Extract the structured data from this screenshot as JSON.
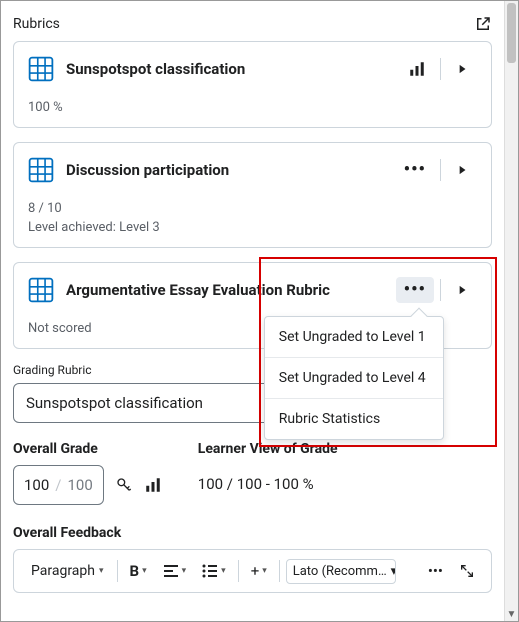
{
  "header": {
    "title": "Rubrics"
  },
  "rubrics": [
    {
      "title": "Sunspotspot classification",
      "score_text": "100 %",
      "level_text": null,
      "show_chart": true,
      "show_more": false
    },
    {
      "title": "Discussion participation",
      "score_text": "8 / 10",
      "level_text": "Level achieved: Level 3",
      "show_chart": false,
      "show_more": true
    },
    {
      "title": "Argumentative Essay Evaluation Rubric",
      "score_text": "Not scored",
      "level_text": null,
      "show_chart": false,
      "show_more": true
    }
  ],
  "dropdown": {
    "items": [
      "Set Ungraded to Level 1",
      "Set Ungraded to Level 4",
      "Rubric Statistics"
    ]
  },
  "grading_rubric": {
    "label": "Grading Rubric",
    "selected": "Sunspotspot classification"
  },
  "overall_grade": {
    "label": "Overall Grade",
    "value": "100",
    "denominator": "100"
  },
  "learner_view": {
    "label": "Learner View of Grade",
    "text": "100 / 100 - 100 %"
  },
  "feedback": {
    "label": "Overall Feedback",
    "toolbar": {
      "para": "Paragraph",
      "bold": "B",
      "plus": "+",
      "font": "Lato (Recomm…",
      "more": "•••"
    }
  }
}
